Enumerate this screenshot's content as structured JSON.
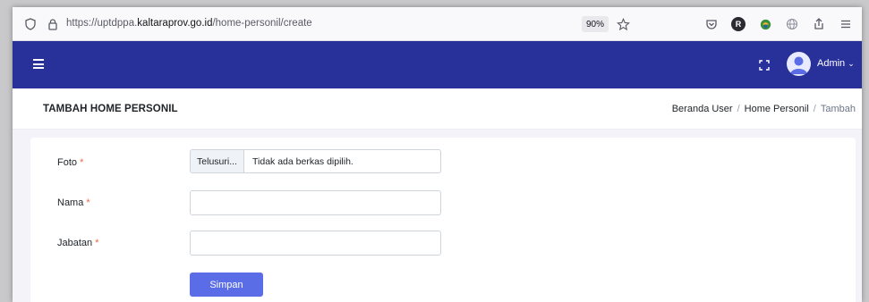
{
  "browser": {
    "url_prefix": "https://uptdppa.",
    "url_host": "kaltaraprov.go.id",
    "url_path": "/home-personil/create",
    "zoom": "90%",
    "profile_badge": "R"
  },
  "header": {
    "user_name": "Admin",
    "user_chevron": "⌄"
  },
  "page": {
    "title": "TAMBAH HOME PERSONIL",
    "breadcrumb": [
      "Beranda User",
      "Home Personil",
      "Tambah"
    ],
    "breadcrumb_sep": "/"
  },
  "form": {
    "required_mark": "*",
    "foto": {
      "label": "Foto",
      "browse_label": "Telusuri...",
      "status": "Tidak ada berkas dipilih."
    },
    "nama": {
      "label": "Nama",
      "value": ""
    },
    "jabatan": {
      "label": "Jabatan",
      "value": ""
    },
    "submit_label": "Simpan"
  },
  "colors": {
    "header_bg": "#28309a",
    "primary_button": "#5a6de6",
    "required": "#f06548"
  }
}
